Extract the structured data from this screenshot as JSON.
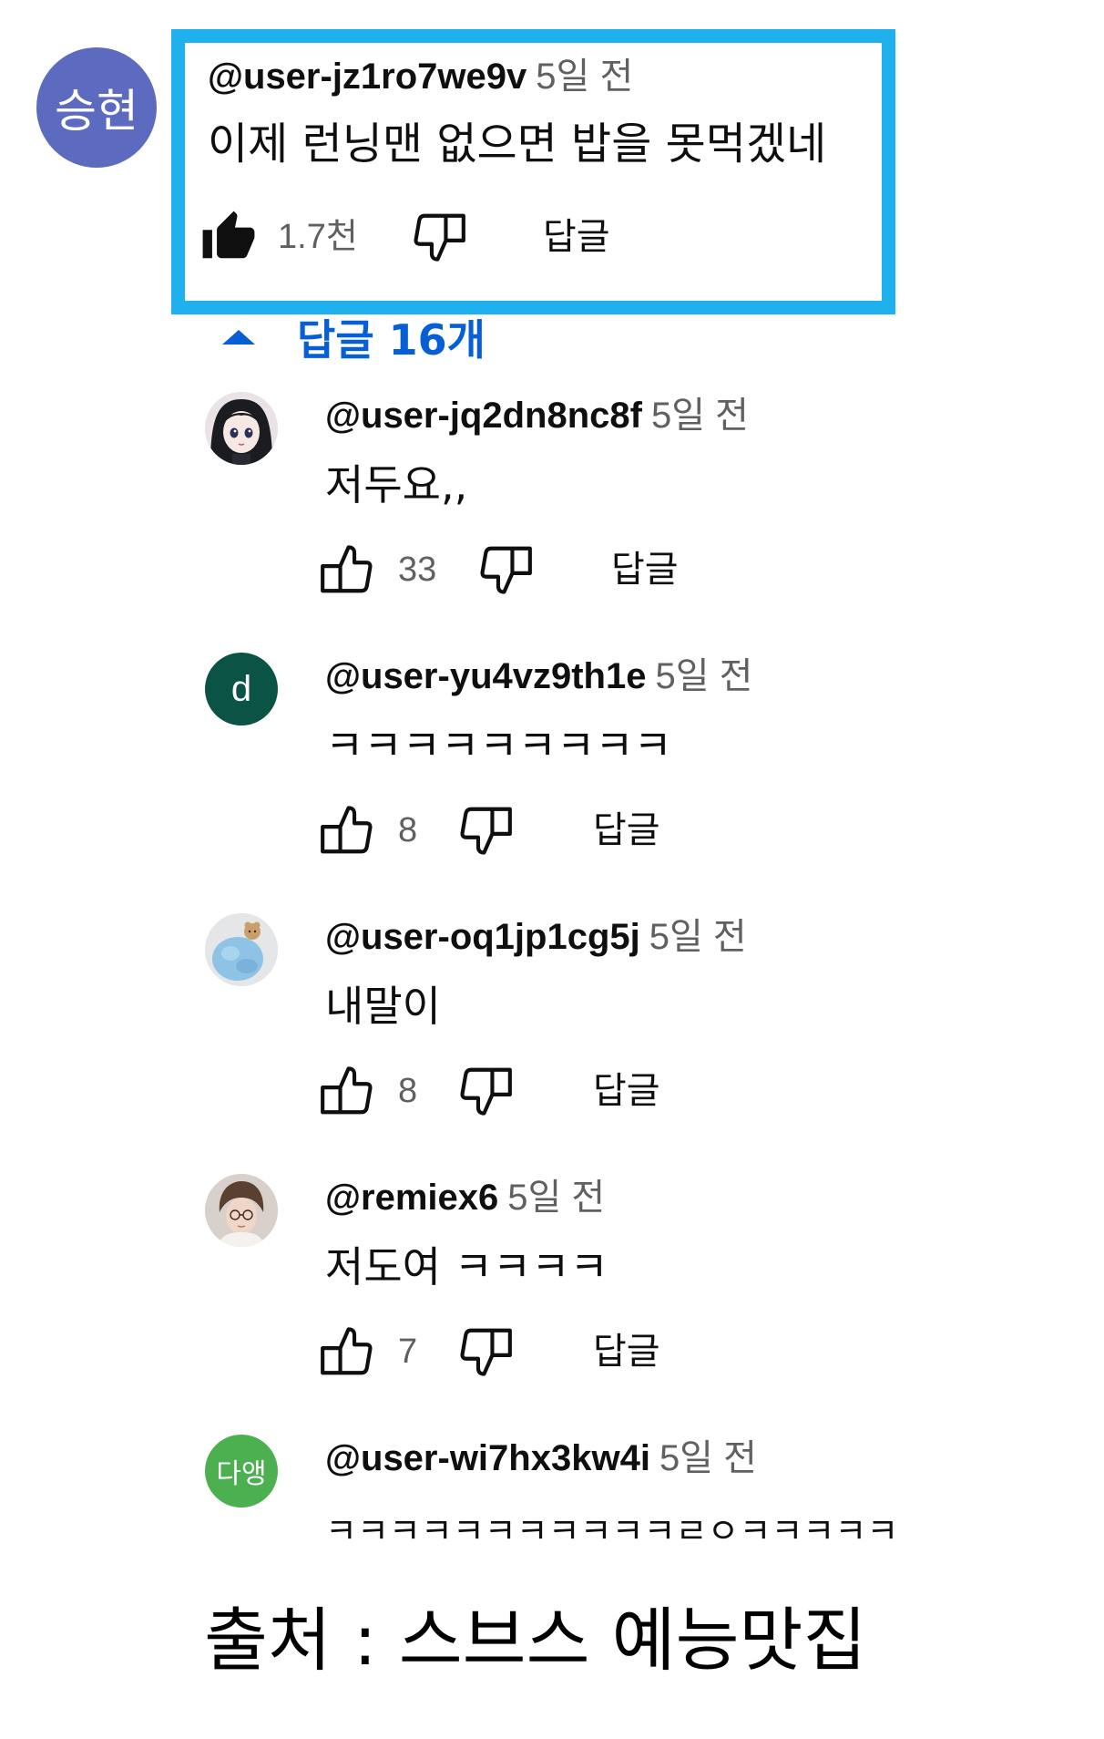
{
  "main_comment": {
    "avatar_text": "승현",
    "avatar_color": "#5c6bc0",
    "handle": "@user-jz1ro7we9v",
    "time": "5일 전",
    "text": "이제 런닝맨 없으면 밥을 못먹겠네",
    "likes": "1.7천",
    "reply_label": "답글",
    "highlight_color": "#1fb0ee"
  },
  "replies_toggle": {
    "label": "답글 16개",
    "color": "#065fd4"
  },
  "replies": [
    {
      "handle": "@user-jq2dn8nc8f",
      "time": "5일 전",
      "text": "저두요,,",
      "likes": "33",
      "reply_label": "답글",
      "avatar_icon": "anime-girl-avatar"
    },
    {
      "handle": "@user-yu4vz9th1e",
      "time": "5일 전",
      "text": "ㅋㅋㅋㅋㅋㅋㅋㅋㅋ",
      "likes": "8",
      "reply_label": "답글",
      "avatar_text": "d",
      "avatar_color": "#0b5345"
    },
    {
      "handle": "@user-oq1jp1cg5j",
      "time": "5일 전",
      "text": "내말이",
      "likes": "8",
      "reply_label": "답글",
      "avatar_icon": "blue-plush-avatar"
    },
    {
      "handle": "@remiex6",
      "time": "5일 전",
      "text": "저도여 ㅋㅋㅋㅋ",
      "likes": "7",
      "reply_label": "답글",
      "avatar_icon": "person-photo-avatar"
    },
    {
      "handle": "@user-wi7hx3kw4i",
      "time": "5일 전",
      "text": "ㅋㅋㅋㅋㅋㅋㅋㅋㅋㅋㅋㄹㅇㅋㅋㅋㅋㅋ",
      "avatar_text": "다앵",
      "avatar_color": "#4caf50"
    }
  ],
  "source_caption": "출처 : 스브스 예능맛집"
}
